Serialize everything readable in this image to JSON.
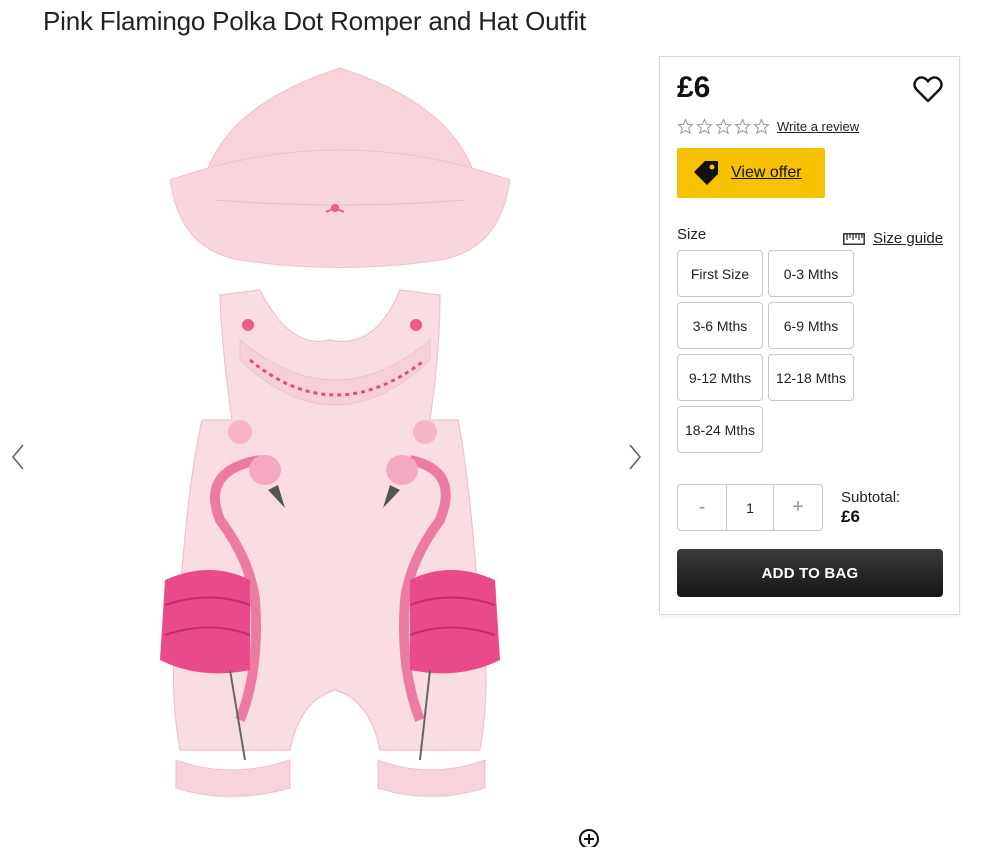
{
  "product": {
    "title": "Pink Flamingo Polka Dot Romper and Hat Outfit"
  },
  "gallery": {
    "prev_icon": "chevron-left-icon",
    "next_icon": "chevron-right-icon",
    "zoom_icon": "zoom-in-icon"
  },
  "panel": {
    "price": "£6",
    "wishlist_icon": "heart-icon",
    "rating": {
      "stars_filled": 0,
      "stars_total": 5,
      "write_review": "Write a review"
    },
    "offer": {
      "label": "View offer",
      "icon": "tag-icon",
      "color": "#f6c200"
    },
    "size_label": "Size",
    "size_guide": {
      "label": "Size guide",
      "icon": "ruler-icon"
    },
    "sizes": [
      "First Size",
      "0-3 Mths",
      "3-6 Mths",
      "6-9 Mths",
      "9-12 Mths",
      "12-18 Mths",
      "18-24 Mths"
    ],
    "quantity": {
      "minus": "-",
      "value": "1",
      "plus": "+"
    },
    "subtotal": {
      "label": "Subtotal:",
      "value": "£6"
    },
    "add_to_bag": "ADD TO BAG"
  }
}
